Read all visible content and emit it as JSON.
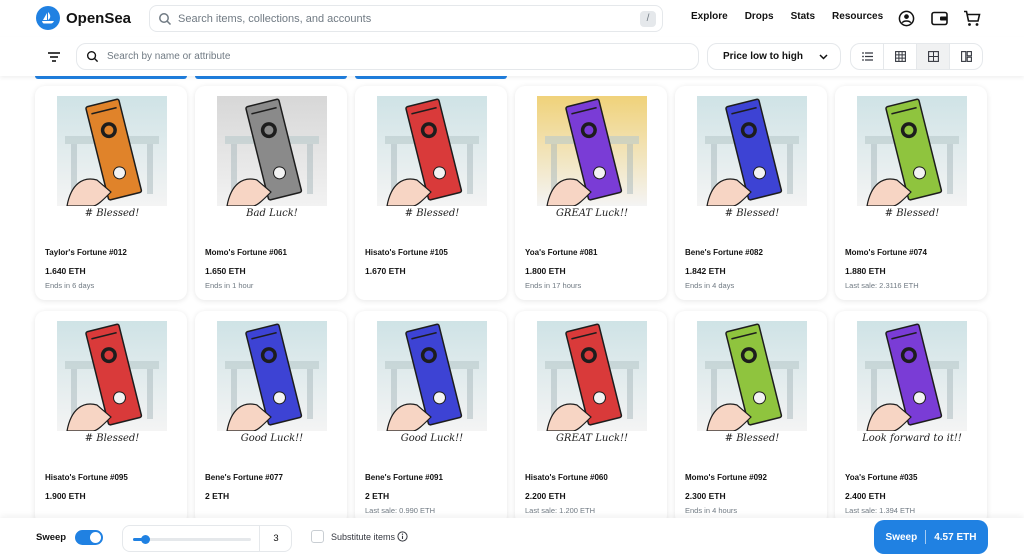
{
  "header": {
    "brand": "OpenSea",
    "search_placeholder": "Search items, collections, and accounts",
    "slash_hint": "/",
    "nav": [
      "Explore",
      "Drops",
      "Stats",
      "Resources"
    ]
  },
  "filterbar": {
    "search_placeholder": "Search by name or attribute",
    "sort_selected": "Price low to high"
  },
  "colors": {
    "accent": "#2081e2",
    "orange": "#e0832a",
    "gray": "#8a8a8a",
    "red": "#d93a3a",
    "purple": "#7a3cd6",
    "blue": "#3d43d4",
    "green": "#8fc43e"
  },
  "cards": [
    {
      "name": "Taylor's Fortune #012",
      "price": "1.640 ETH",
      "sub": "Ends in 6 days",
      "color": "orange",
      "caption": "# Blessed!",
      "icon": "sticker-icon"
    },
    {
      "name": "Momo's Fortune #061",
      "price": "1.650 ETH",
      "sub": "Ends in 1 hour",
      "color": "gray",
      "caption": "Bad Luck!",
      "icon": "sticker-icon"
    },
    {
      "name": "Hisato's Fortune #105",
      "price": "1.670 ETH",
      "sub": "",
      "color": "red",
      "caption": "# Blessed!",
      "icon": "sticker-icon"
    },
    {
      "name": "Yoa's Fortune #081",
      "price": "1.800 ETH",
      "sub": "Ends in 17 hours",
      "color": "purple",
      "caption": "GREAT Luck!!",
      "icon": "sticker-icon"
    },
    {
      "name": "Bene's Fortune #082",
      "price": "1.842 ETH",
      "sub": "Ends in 4 days",
      "color": "blue",
      "caption": "# Blessed!",
      "icon": "sticker-icon"
    },
    {
      "name": "Momo's Fortune #074",
      "price": "1.880 ETH",
      "sub": "Last sale: 2.3116 ETH",
      "color": "green",
      "caption": "# Blessed!",
      "icon": "sticker-icon"
    },
    {
      "name": "Hisato's Fortune #095",
      "price": "1.900 ETH",
      "sub": "",
      "color": "red",
      "caption": "# Blessed!",
      "icon": "sticker-icon"
    },
    {
      "name": "Bene's Fortune #077",
      "price": "2 ETH",
      "sub": "",
      "color": "blue",
      "caption": "Good Luck!!",
      "icon": "sticker-icon"
    },
    {
      "name": "Bene's Fortune #091",
      "price": "2 ETH",
      "sub": "Last sale: 0.990 ETH",
      "color": "blue",
      "caption": "Good Luck!!",
      "icon": "sticker-icon"
    },
    {
      "name": "Hisato's Fortune #060",
      "price": "2.200 ETH",
      "sub": "Last sale: 1.200 ETH",
      "color": "red",
      "caption": "GREAT Luck!!",
      "icon": "sticker-icon"
    },
    {
      "name": "Momo's Fortune #092",
      "price": "2.300 ETH",
      "sub": "Ends in 4 hours",
      "color": "green",
      "caption": "# Blessed!",
      "icon": "sticker-icon"
    },
    {
      "name": "Yoa's Fortune #035",
      "price": "2.400 ETH",
      "sub": "Last sale: 1.394 ETH",
      "color": "purple",
      "caption": "Look forward to it!!",
      "icon": "sticker-icon"
    }
  ],
  "sweep": {
    "label": "Sweep",
    "enabled": true,
    "count": "3",
    "slider_fraction": 0.1,
    "substitute_label": "Substitute items",
    "button_label": "Sweep",
    "button_total": "4.57 ETH"
  }
}
